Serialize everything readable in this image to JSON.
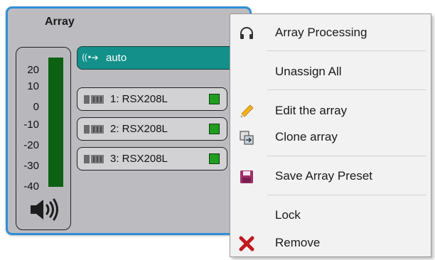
{
  "panel": {
    "title": "Array",
    "meter": {
      "scale": [
        "20",
        "10",
        "0",
        "-10",
        "-20",
        "-30",
        "-40"
      ],
      "level_fraction": 1.0,
      "icon": "speaker-volume-icon"
    },
    "auto": {
      "label": "auto",
      "icon": "signal-arrow-icon"
    },
    "speakers": [
      {
        "label": "1: RSX208L",
        "icon": "loudspeaker-icon",
        "status_color": "#1f9e1f"
      },
      {
        "label": "2: RSX208L",
        "icon": "loudspeaker-icon",
        "status_color": "#1f9e1f"
      },
      {
        "label": "3: RSX208L",
        "icon": "loudspeaker-icon",
        "status_color": "#1f9e1f"
      }
    ]
  },
  "menu": {
    "items": [
      {
        "label": "Array Processing",
        "icon": "headphones-icon"
      },
      {
        "label": "Unassign All",
        "icon": ""
      },
      {
        "label": "Edit the array",
        "icon": "pencil-icon"
      },
      {
        "label": "Clone array",
        "icon": "clone-icon"
      },
      {
        "label": "Save Array Preset",
        "icon": "save-disk-icon"
      },
      {
        "label": "Lock",
        "icon": ""
      },
      {
        "label": "Remove",
        "icon": "remove-x-icon"
      }
    ]
  },
  "colors": {
    "panel_border": "#2f8fd6",
    "panel_bg": "#bcbcc0",
    "auto_bg": "#13908a",
    "meter_fill": "#0c6212",
    "save_icon": "#a0306a",
    "remove_icon": "#c0191e"
  }
}
